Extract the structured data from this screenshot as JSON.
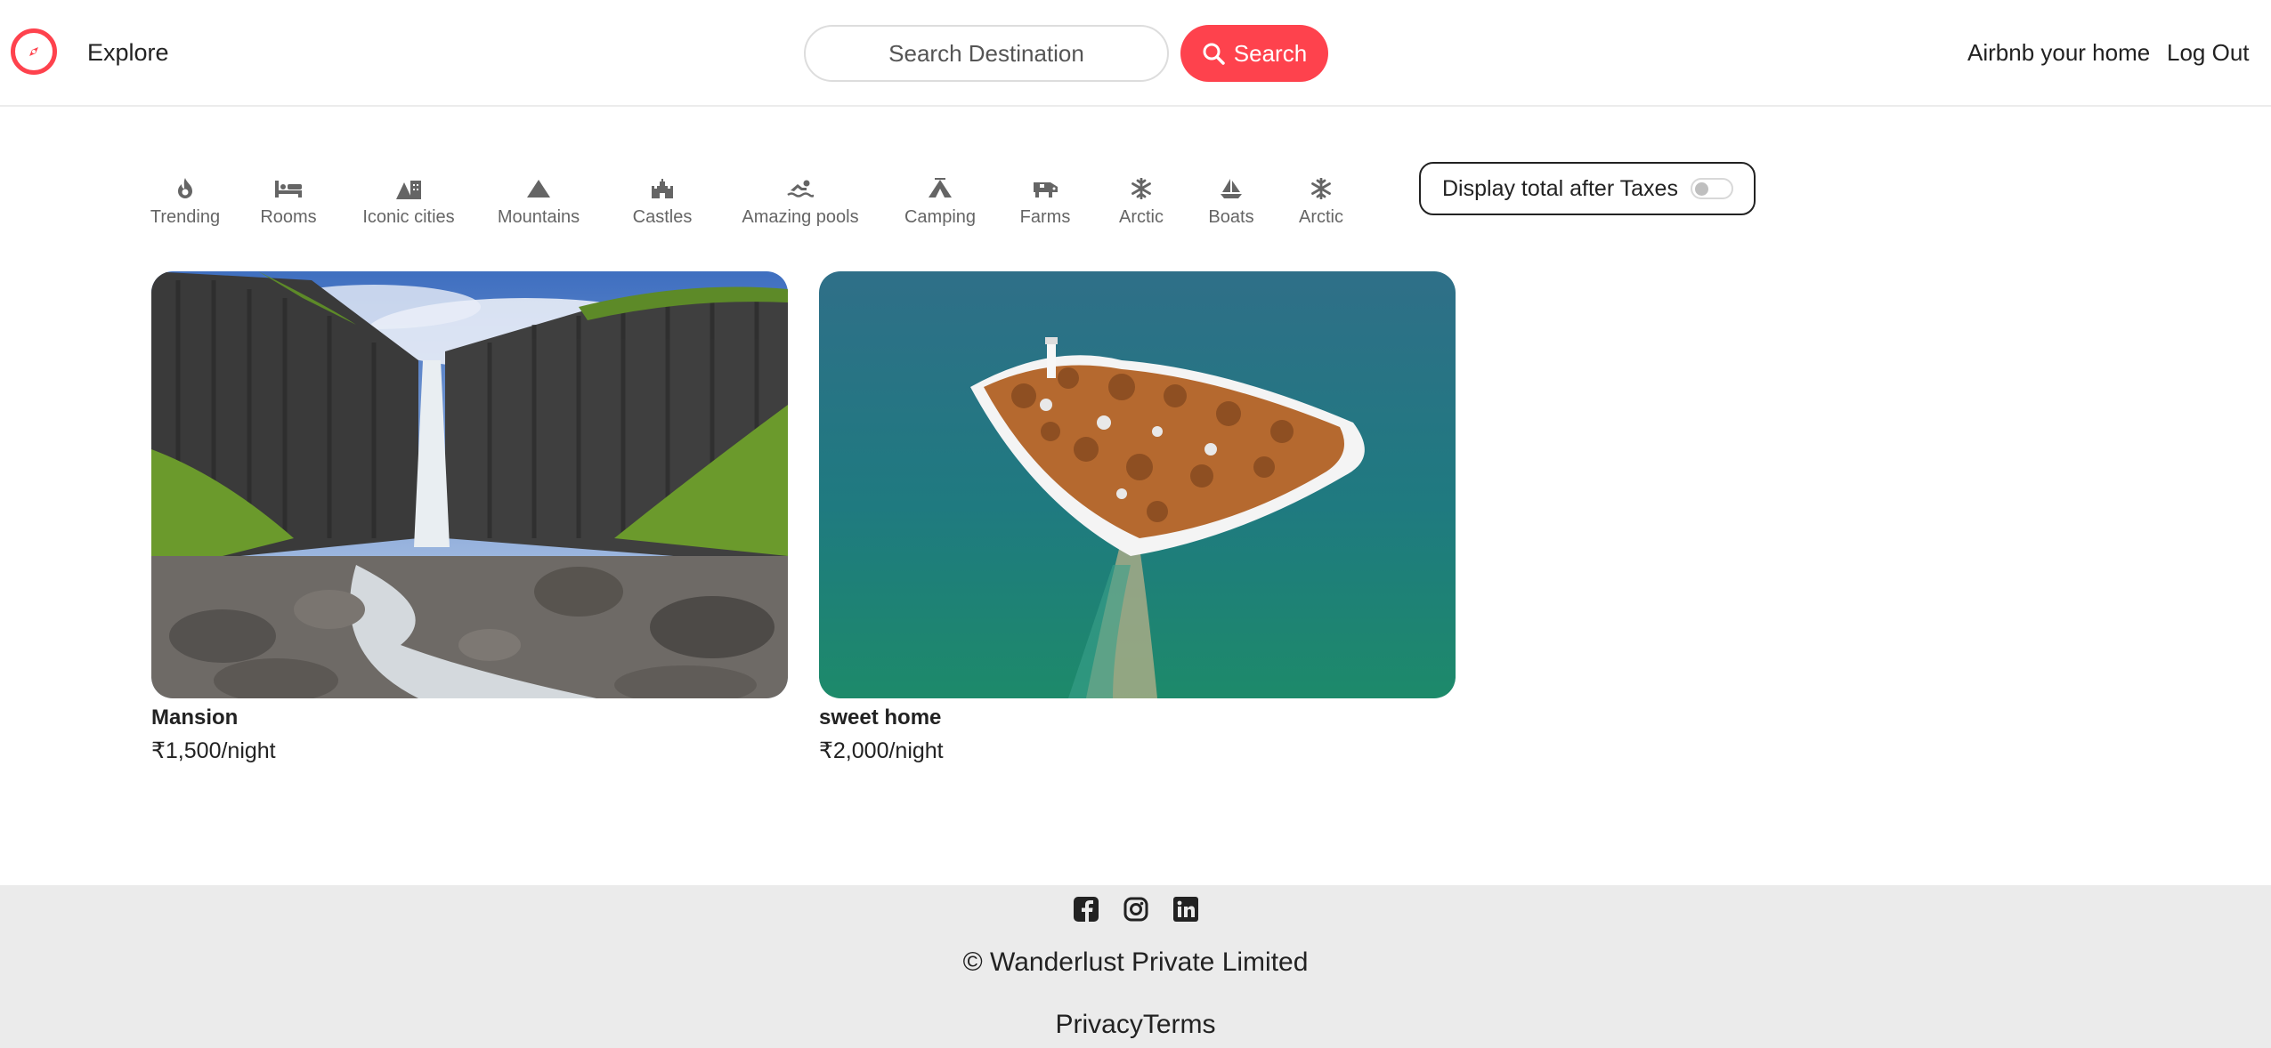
{
  "navbar": {
    "brand_icon": "compass-icon",
    "explore": "Explore",
    "search_placeholder": "Search Destination",
    "search_button": "Search",
    "host_link": "Airbnb your home",
    "logout_link": "Log Out",
    "accent_color": "#fe424d"
  },
  "filters": [
    {
      "label": "Trending",
      "icon": "fire-icon"
    },
    {
      "label": "Rooms",
      "icon": "bed-icon"
    },
    {
      "label": "Iconic cities",
      "icon": "mountain-city-icon"
    },
    {
      "label": "Mountains",
      "icon": "mountain-icon"
    },
    {
      "label": "Castles",
      "icon": "castle-icon"
    },
    {
      "label": "Amazing pools",
      "icon": "person-swimming-icon"
    },
    {
      "label": "Camping",
      "icon": "campground-icon"
    },
    {
      "label": "Farms",
      "icon": "cow-icon"
    },
    {
      "label": "Arctic",
      "icon": "snowflake-icon"
    },
    {
      "label": "Boats",
      "icon": "sailboat-icon"
    },
    {
      "label": "Arctic",
      "icon": "snowflake-icon"
    }
  ],
  "tax_toggle": {
    "label": "Display total after Taxes",
    "checked": false
  },
  "listings": [
    {
      "title": "Mansion",
      "price": "₹1,500/night",
      "image": "waterfall-photo"
    },
    {
      "title": "sweet home",
      "price": "₹2,000/night",
      "image": "island-lighthouse-photo"
    }
  ],
  "footer": {
    "socials": [
      "facebook-icon",
      "instagram-icon",
      "linkedin-icon"
    ],
    "copyright": "© Wanderlust Private Limited",
    "links": "PrivacyTerms"
  }
}
